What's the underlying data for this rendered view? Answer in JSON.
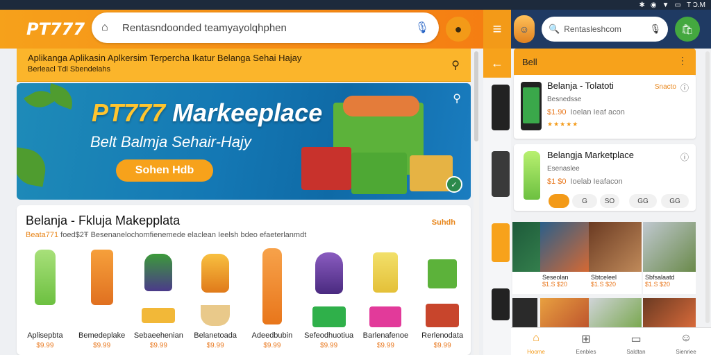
{
  "status": {
    "time": "T Ͻ.M",
    "icons": [
      "bluetooth-icon",
      "wifi-icon",
      "signal-icon",
      "battery-icon"
    ]
  },
  "header": {
    "logo": "PT777",
    "search_value": "Rentasndoonded teamyayolqhphen",
    "right_search_value": "Rentasleshcom"
  },
  "tagline": {
    "line1": "Aplikanga Aplikasin Aplkersim Terpercha Ikatur Belanga Sehai Hajay",
    "line2": "Berleacl Tdl Sbendelahs"
  },
  "banner": {
    "title_accent": "PT777",
    "title_rest": " Markeeplace",
    "subtitle": "Belt Balmja Sehair-Hajy",
    "cta": "Sohen Hdb"
  },
  "products": {
    "title": "Belanja - Fkluja Makepplata",
    "see_all": "Suhdh",
    "subtitle_accent": "Beata771",
    "subtitle_rest": " foed$2Ŧ Besenanelochomfienemede elaclean Ieelsh bdeo efaeterlanmdt",
    "items": [
      {
        "name": "Aplisepbta",
        "price": "$9.99"
      },
      {
        "name": "Bemedeplake",
        "price": "$9.99"
      },
      {
        "name": "Sebaeehenian",
        "price": "$9.99"
      },
      {
        "name": "Belanetoada",
        "price": "$9.99"
      },
      {
        "name": "Adeedbubin",
        "price": "$9.99"
      },
      {
        "name": "Sefeodhuotiua",
        "price": "$9.99"
      },
      {
        "name": "Barlenafenoe",
        "price": "$9.99"
      },
      {
        "name": "Rerlenodata",
        "price": "$9.99"
      }
    ]
  },
  "right_panel": {
    "header": "Bell",
    "card1": {
      "name": "Belanja - Tolatoti",
      "tag": "Snacto",
      "sub": "Besnedsse",
      "price": "$1.90",
      "meta": "Ioelan Ieaf acon"
    },
    "card2": {
      "name": "Belangja Marketplace",
      "sub": "Esenaslee",
      "price": "$1 $0",
      "meta": "Ioelab Ieafacon",
      "chips": [
        "",
        "G",
        "S",
        "SO",
        "",
        "GG",
        "GG"
      ]
    },
    "grid": [
      {
        "label": "Seseolan",
        "price": "$1.S $20"
      },
      {
        "label": "Sbtceleel",
        "price": "$1.S $20"
      },
      {
        "label": "Sbfsalaatd",
        "price": "$1.S $20"
      },
      {
        "label": "",
        "price": ""
      },
      {
        "label": "",
        "price": ""
      },
      {
        "label": "",
        "price": ""
      }
    ]
  },
  "bottom_nav": [
    {
      "label": "Hoome",
      "icon": "home-icon"
    },
    {
      "label": "Eenbles",
      "icon": "category-icon"
    },
    {
      "label": "Saldtan",
      "icon": "chat-icon"
    },
    {
      "label": "Sienriee",
      "icon": "profile-icon"
    }
  ],
  "colors": {
    "accent": "#f39a18",
    "banner": "#1478b4",
    "navy": "#1f3a63",
    "price": "#e8761b"
  }
}
